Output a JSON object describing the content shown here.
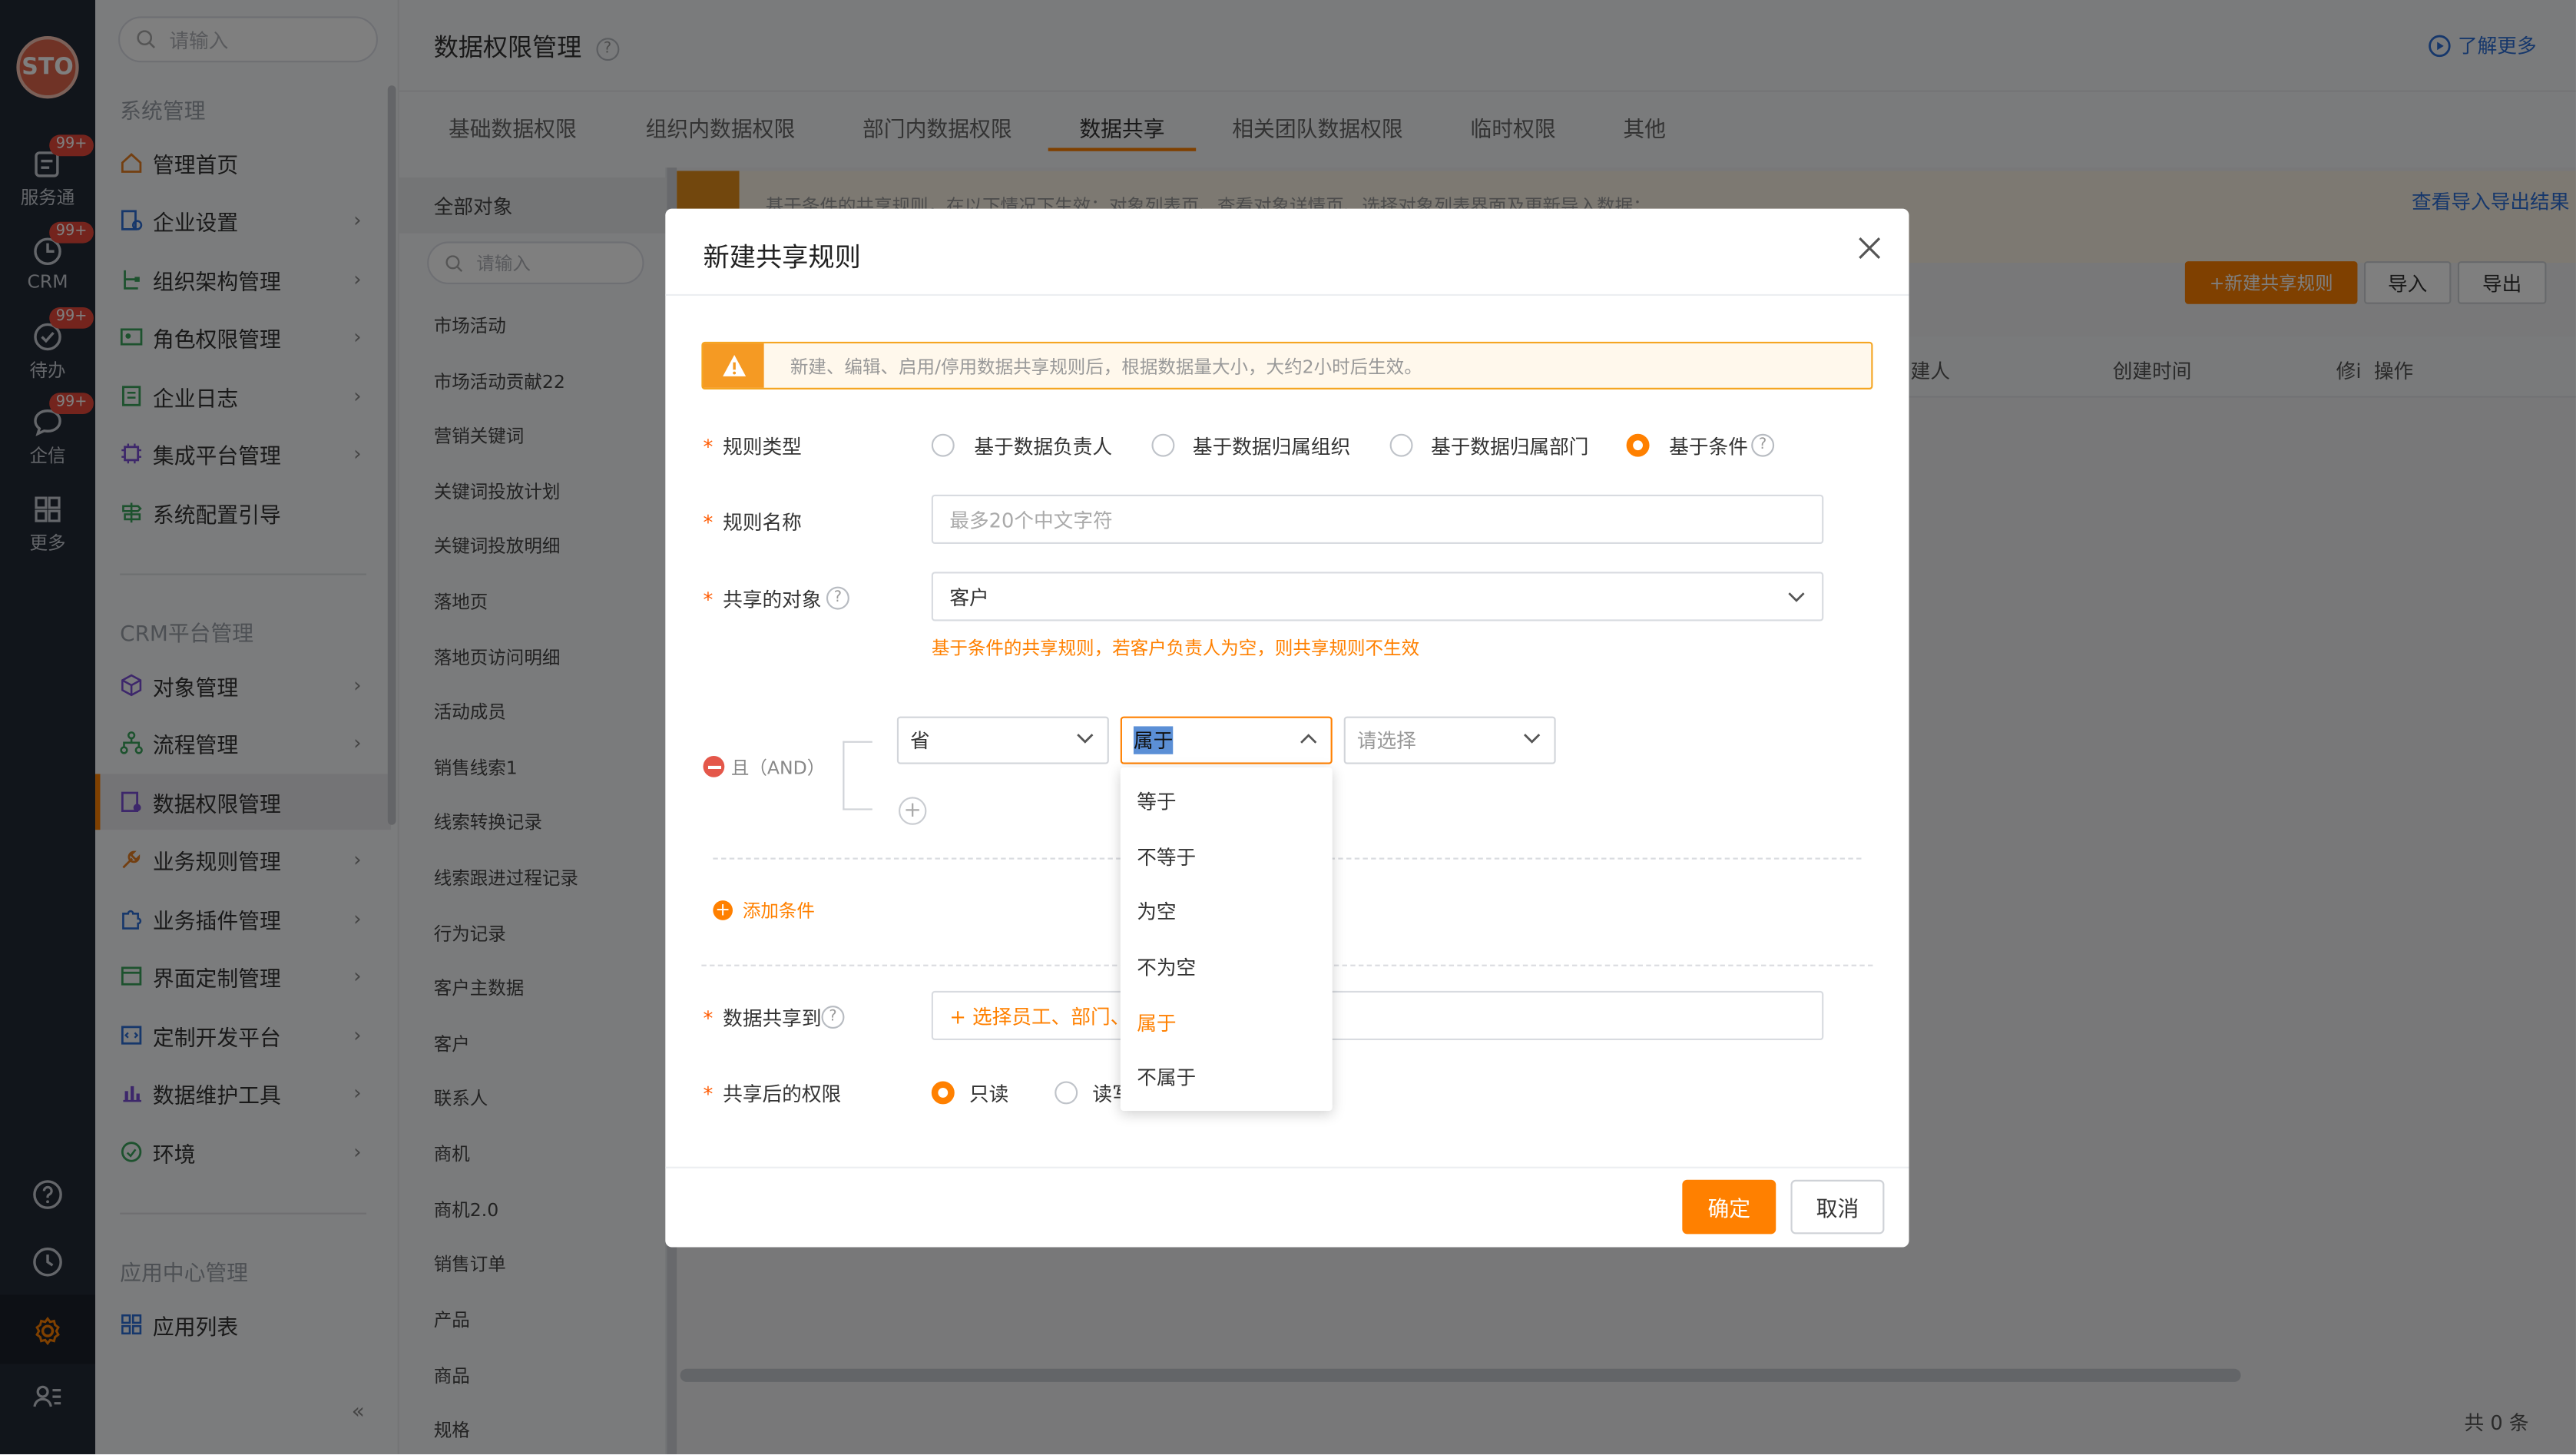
{
  "rail": {
    "logo": "STO",
    "items": [
      {
        "label": "服务通",
        "badge": "99+"
      },
      {
        "label": "CRM",
        "badge": "99+"
      },
      {
        "label": "待办",
        "badge": "99+"
      },
      {
        "label": "企信",
        "badge": "99+"
      },
      {
        "label": "更多",
        "badge": ""
      }
    ]
  },
  "menu": {
    "search_placeholder": "请输入",
    "sections": [
      {
        "title": "系统管理",
        "items": [
          "管理首页",
          "企业设置",
          "组织架构管理",
          "角色权限管理",
          "企业日志",
          "集成平台管理",
          "系统配置引导"
        ]
      },
      {
        "title": "CRM平台管理",
        "items": [
          "对象管理",
          "流程管理",
          "数据权限管理",
          "业务规则管理",
          "业务插件管理",
          "界面定制管理",
          "定制开发平台",
          "数据维护工具",
          "环境"
        ]
      },
      {
        "title": "应用中心管理",
        "items": [
          "应用列表"
        ]
      }
    ],
    "collapse": "«"
  },
  "header": {
    "title": "数据权限管理",
    "help": "?",
    "learn_more": "了解更多"
  },
  "tabs": [
    "基础数据权限",
    "组织内数据权限",
    "部门内数据权限",
    "数据共享",
    "相关团队数据权限",
    "临时权限",
    "其他"
  ],
  "active_tab": "数据共享",
  "objects": {
    "all": "全部对象",
    "search_placeholder": "请输入",
    "items": [
      "市场活动",
      "市场活动贡献22",
      "营销关键词",
      "关键词投放计划",
      "关键词投放明细",
      "落地页",
      "落地页访问明细",
      "活动成员",
      "销售线索1",
      "线索转换记录",
      "线索跟进过程记录",
      "行为记录",
      "客户主数据",
      "客户",
      "联系人",
      "商机",
      "商机2.0",
      "销售订单",
      "产品",
      "商品",
      "规格"
    ]
  },
  "main": {
    "notice": "基于条件的共享规则，在以下情况下生效：对象列表页、查看对象详情页、选择对象列表界面及更新导入数据；",
    "export_link": "查看导入导出结果",
    "buttons": {
      "new_rule": "+新建共享规则",
      "import": "导入",
      "export": "导出"
    },
    "columns": [
      "建人",
      "创建时间",
      "修i",
      "操作"
    ],
    "total": "共 0 条"
  },
  "dialog": {
    "title": "新建共享规则",
    "warning": "新建、编辑、启用/停用数据共享规则后，根据数据量大小，大约2小时后生效。",
    "rule_type_label": "规则类型",
    "rule_types": [
      "基于数据负责人",
      "基于数据归属组织",
      "基于数据归属部门",
      "基于条件"
    ],
    "rule_type_selected": "基于条件",
    "rule_name_label": "规则名称",
    "rule_name_placeholder": "最多20个中文字符",
    "object_label": "共享的对象",
    "object_value": "客户",
    "object_hint": "基于条件的共享规则，若客户负责人为空，则共享规则不生效",
    "logic_label": "且（AND）",
    "condition": {
      "field": "省",
      "operator": "属于",
      "value_placeholder": "请选择"
    },
    "add_condition": "添加条件",
    "share_to_label": "数据共享到",
    "share_to_placeholder": "+ 选择员工、部门、用",
    "permission_label": "共享后的权限",
    "permissions": [
      "只读",
      "读写"
    ],
    "permission_selected": "只读",
    "ok": "确定",
    "cancel": "取消"
  },
  "operator_dropdown": {
    "options": [
      "等于",
      "不等于",
      "为空",
      "不为空",
      "属于",
      "不属于"
    ],
    "selected": "属于"
  },
  "colors": {
    "accent": "#ff8000",
    "rail": "#232a36",
    "link": "#2c6fd6",
    "badge": "#e8483b"
  }
}
